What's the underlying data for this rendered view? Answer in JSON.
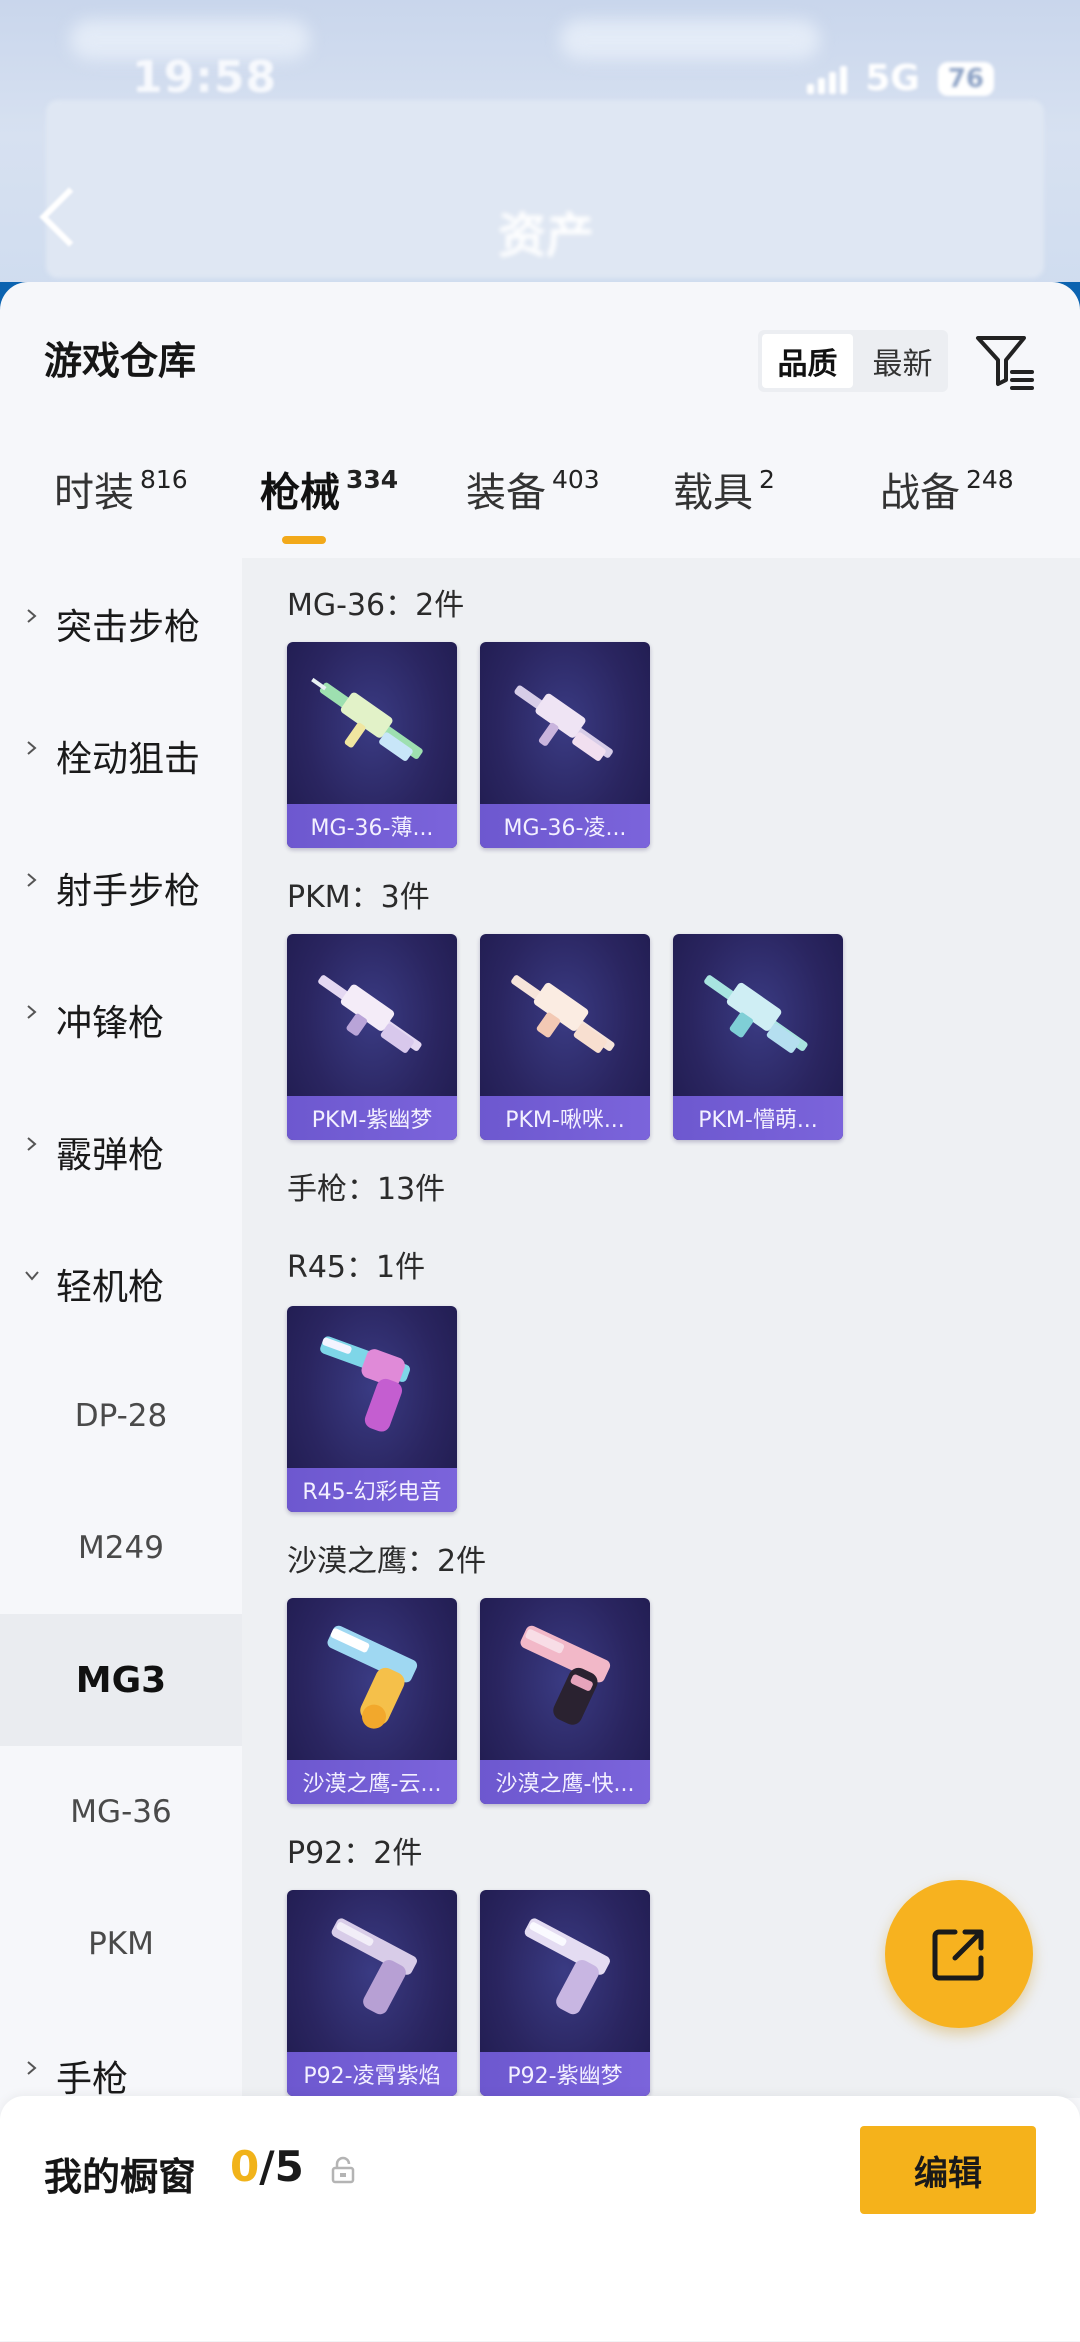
{
  "status_bar": {
    "time": "19:58",
    "network": "5G",
    "battery": "76"
  },
  "nav": {
    "title": "资产"
  },
  "header": {
    "title": "游戏仓库",
    "sort": [
      "品质",
      "最新"
    ]
  },
  "tabs": [
    {
      "label": "时装",
      "count": "816"
    },
    {
      "label": "枪械",
      "count": "334"
    },
    {
      "label": "装备",
      "count": "403"
    },
    {
      "label": "载具",
      "count": "2"
    },
    {
      "label": "战备",
      "count": "248"
    }
  ],
  "sidebar": {
    "categories": [
      "突击步枪",
      "栓动狙击",
      "射手步枪",
      "冲锋枪",
      "霰弹枪",
      "轻机枪"
    ],
    "sub_items": [
      "DP-28",
      "M249",
      "MG3",
      "MG-36",
      "PKM"
    ],
    "last_category": "手枪"
  },
  "groups": [
    {
      "title": "MG-36：2件",
      "items": [
        "MG-36-薄...",
        "MG-36-凌..."
      ]
    },
    {
      "title": "PKM：3件",
      "items": [
        "PKM-紫幽梦",
        "PKM-啾咪...",
        "PKM-懵萌..."
      ]
    },
    {
      "title": "手枪：13件",
      "items": []
    },
    {
      "title": "R45：1件",
      "items": [
        "R45-幻彩电音"
      ]
    },
    {
      "title": "沙漠之鹰：2件",
      "items": [
        "沙漠之鹰-云...",
        "沙漠之鹰-快..."
      ]
    },
    {
      "title": "P92：2件",
      "items": [
        "P92-凌霄紫焰",
        "P92-紫幽梦"
      ]
    }
  ],
  "showcase": {
    "label": "我的橱窗",
    "current": "0",
    "separator": "/",
    "max": "5"
  },
  "edit_label": "编辑",
  "colors": {
    "accent": "#f5b21b",
    "card_bg": "#2a2560",
    "card_bar": "#7460d6"
  },
  "icons": {
    "filter": "filter-icon",
    "share": "share-icon",
    "lock": "lock-icon",
    "back": "back-arrow-icon"
  }
}
